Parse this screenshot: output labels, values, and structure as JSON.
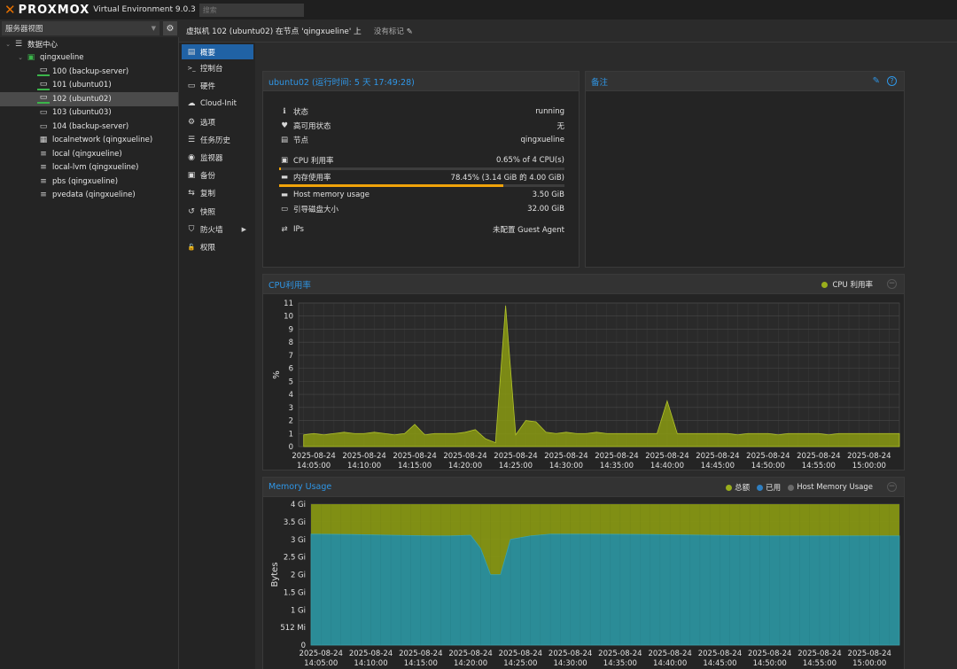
{
  "topbar": {
    "brand": "PROXMOX",
    "version": "Virtual Environment 9.0.3",
    "search_placeholder": "搜索"
  },
  "left": {
    "view_select": "服务器视图",
    "tree": [
      {
        "label": "数据中心",
        "icon": "datacenter-icon",
        "level": 0
      },
      {
        "label": "qingxueline",
        "icon": "node-online-icon",
        "level": 1
      },
      {
        "label": "100 (backup-server)",
        "icon": "vm-running-icon",
        "level": 2
      },
      {
        "label": "101 (ubuntu01)",
        "icon": "vm-running-icon",
        "level": 2
      },
      {
        "label": "102 (ubuntu02)",
        "icon": "vm-running-icon",
        "level": 2,
        "selected": true
      },
      {
        "label": "103 (ubuntu03)",
        "icon": "vm-stopped-icon",
        "level": 2
      },
      {
        "label": "104 (backup-server)",
        "icon": "vm-stopped-icon",
        "level": 2
      },
      {
        "label": "localnetwork (qingxueline)",
        "icon": "network-grid-icon",
        "level": 2
      },
      {
        "label": "local (qingxueline)",
        "icon": "storage-icon",
        "level": 2
      },
      {
        "label": "local-lvm (qingxueline)",
        "icon": "storage-icon",
        "level": 2
      },
      {
        "label": "pbs (qingxueline)",
        "icon": "storage-icon",
        "level": 2
      },
      {
        "label": "pvedata (qingxueline)",
        "icon": "storage-icon",
        "level": 2
      }
    ]
  },
  "vmheader": {
    "title": "虚拟机 102 (ubuntu02) 在节点 'qingxueline' 上",
    "tags": "没有标记"
  },
  "menu": [
    {
      "label": "概要",
      "icon": "summary-icon",
      "active": true
    },
    {
      "label": "控制台",
      "icon": "console-icon"
    },
    {
      "label": "硬件",
      "icon": "hardware-icon"
    },
    {
      "label": "Cloud-Init",
      "icon": "cloud-icon"
    },
    {
      "label": "选项",
      "icon": "options-gear-icon"
    },
    {
      "label": "任务历史",
      "icon": "task-history-icon"
    },
    {
      "label": "监视器",
      "icon": "monitor-eye-icon"
    },
    {
      "label": "备份",
      "icon": "backup-floppy-icon"
    },
    {
      "label": "复制",
      "icon": "replication-icon"
    },
    {
      "label": "快照",
      "icon": "snapshot-icon"
    },
    {
      "label": "防火墙",
      "icon": "firewall-shield-icon",
      "submenu": true
    },
    {
      "label": "权限",
      "icon": "permissions-unlock-icon"
    }
  ],
  "status": {
    "title": "ubuntu02 (运行时间: 5 天 17:49:28)",
    "state_label": "状态",
    "state_value": "running",
    "ha_label": "高可用状态",
    "ha_value": "无",
    "node_label": "节点",
    "node_value": "qingxueline",
    "cpu_label": "CPU 利用率",
    "cpu_value": "0.65% of 4 CPU(s)",
    "cpu_fraction": 0.0065,
    "mem_label": "内存使用率",
    "mem_value": "78.45% (3.14 GiB 的 4.00 GiB)",
    "mem_fraction": 0.7845,
    "hostmem_label": "Host memory usage",
    "hostmem_value": "3.50 GiB",
    "disk_label": "引导磁盘大小",
    "disk_value": "32.00 GiB",
    "ips_label": "IPs",
    "ips_value": "未配置 Guest Agent"
  },
  "notes": {
    "title": "备注"
  },
  "cpu_chart_title": "CPU利用率",
  "mem_chart_title": "Memory Usage",
  "chart_data": [
    {
      "type": "area",
      "title": "CPU利用率",
      "ylabel": "%",
      "ylim": [
        0,
        11
      ],
      "yticks": [
        "0",
        "1",
        "2",
        "3",
        "4",
        "5",
        "6",
        "7",
        "8",
        "9",
        "10",
        "11"
      ],
      "xticks": [
        [
          "2025-08-24",
          "14:05:00"
        ],
        [
          "2025-08-24",
          "14:10:00"
        ],
        [
          "2025-08-24",
          "14:15:00"
        ],
        [
          "2025-08-24",
          "14:20:00"
        ],
        [
          "2025-08-24",
          "14:25:00"
        ],
        [
          "2025-08-24",
          "14:30:00"
        ],
        [
          "2025-08-24",
          "14:35:00"
        ],
        [
          "2025-08-24",
          "14:40:00"
        ],
        [
          "2025-08-24",
          "14:45:00"
        ],
        [
          "2025-08-24",
          "14:50:00"
        ],
        [
          "2025-08-24",
          "14:55:00"
        ],
        [
          "2025-08-24",
          "15:00:00"
        ]
      ],
      "series": [
        {
          "name": "CPU 利用率",
          "color": "#9aae1c",
          "t": [
            "14:04:00",
            "14:05:00",
            "14:06:00",
            "14:07:00",
            "14:08:00",
            "14:09:00",
            "14:10:00",
            "14:11:00",
            "14:12:00",
            "14:13:00",
            "14:14:00",
            "14:15:00",
            "14:16:00",
            "14:17:00",
            "14:18:00",
            "14:19:00",
            "14:20:00",
            "14:21:00",
            "14:22:00",
            "14:23:00",
            "14:24:00",
            "14:25:00",
            "14:26:00",
            "14:27:00",
            "14:28:00",
            "14:29:00",
            "14:30:00",
            "14:31:00",
            "14:32:00",
            "14:33:00",
            "14:34:00",
            "14:35:00",
            "14:36:00",
            "14:37:00",
            "14:38:00",
            "14:39:00",
            "14:40:00",
            "14:41:00",
            "14:42:00",
            "14:43:00",
            "14:44:00",
            "14:45:00",
            "14:46:00",
            "14:47:00",
            "14:48:00",
            "14:49:00",
            "14:50:00",
            "14:51:00",
            "14:52:00",
            "14:53:00",
            "14:54:00",
            "14:55:00",
            "14:56:00",
            "14:57:00",
            "14:58:00",
            "14:59:00",
            "15:00:00",
            "15:01:00",
            "15:02:00",
            "15:03:00"
          ],
          "values": [
            0.9,
            1.0,
            0.9,
            1.0,
            1.1,
            1.0,
            1.0,
            1.1,
            1.0,
            0.9,
            1.0,
            1.7,
            0.9,
            1.0,
            1.0,
            1.0,
            1.1,
            1.3,
            0.6,
            0.3,
            10.8,
            0.9,
            2.0,
            1.9,
            1.1,
            1.0,
            1.1,
            1.0,
            1.0,
            1.1,
            1.0,
            1.0,
            1.0,
            1.0,
            1.0,
            1.0,
            3.5,
            1.0,
            1.0,
            1.0,
            1.0,
            1.0,
            1.0,
            0.9,
            1.0,
            1.0,
            1.0,
            0.9,
            1.0,
            1.0,
            1.0,
            1.0,
            0.9,
            1.0,
            1.0,
            1.0,
            1.0,
            1.0,
            1.0,
            1.0
          ]
        }
      ]
    },
    {
      "type": "area",
      "title": "Memory Usage",
      "ylabel": "Bytes",
      "ylim": [
        0,
        4
      ],
      "yticks": [
        "0",
        "512 Mi",
        "1 Gi",
        "1.5 Gi",
        "2 Gi",
        "2.5 Gi",
        "3 Gi",
        "3.5 Gi",
        "4 Gi"
      ],
      "xticks": [
        [
          "2025-08-24",
          "14:05:00"
        ],
        [
          "2025-08-24",
          "14:10:00"
        ],
        [
          "2025-08-24",
          "14:15:00"
        ],
        [
          "2025-08-24",
          "14:20:00"
        ],
        [
          "2025-08-24",
          "14:25:00"
        ],
        [
          "2025-08-24",
          "14:30:00"
        ],
        [
          "2025-08-24",
          "14:35:00"
        ],
        [
          "2025-08-24",
          "14:40:00"
        ],
        [
          "2025-08-24",
          "14:45:00"
        ],
        [
          "2025-08-24",
          "14:50:00"
        ],
        [
          "2025-08-24",
          "14:55:00"
        ],
        [
          "2025-08-24",
          "15:00:00"
        ]
      ],
      "legend": [
        {
          "name": "总额",
          "color": "#9aae1c"
        },
        {
          "name": "已用",
          "color": "#2f7fc1"
        },
        {
          "name": "Host Memory Usage",
          "color": "#6a6a6a"
        }
      ],
      "total": {
        "name": "总额",
        "color": "#8a9a12",
        "value": 4.0
      },
      "used": {
        "name": "已用",
        "color": "#2b8c97",
        "t": [
          "14:04:00",
          "14:08:00",
          "14:12:00",
          "14:16:00",
          "14:18:00",
          "14:20:00",
          "14:21:00",
          "14:22:00",
          "14:23:00",
          "14:24:00",
          "14:25:00",
          "14:26:00",
          "14:28:00",
          "14:32:00",
          "14:38:00",
          "14:44:00",
          "14:50:00",
          "14:56:00",
          "15:03:00"
        ],
        "values": [
          3.15,
          3.14,
          3.12,
          3.1,
          3.1,
          3.12,
          2.75,
          2.0,
          2.0,
          3.0,
          3.05,
          3.1,
          3.15,
          3.15,
          3.14,
          3.12,
          3.1,
          3.1,
          3.1
        ]
      }
    }
  ]
}
